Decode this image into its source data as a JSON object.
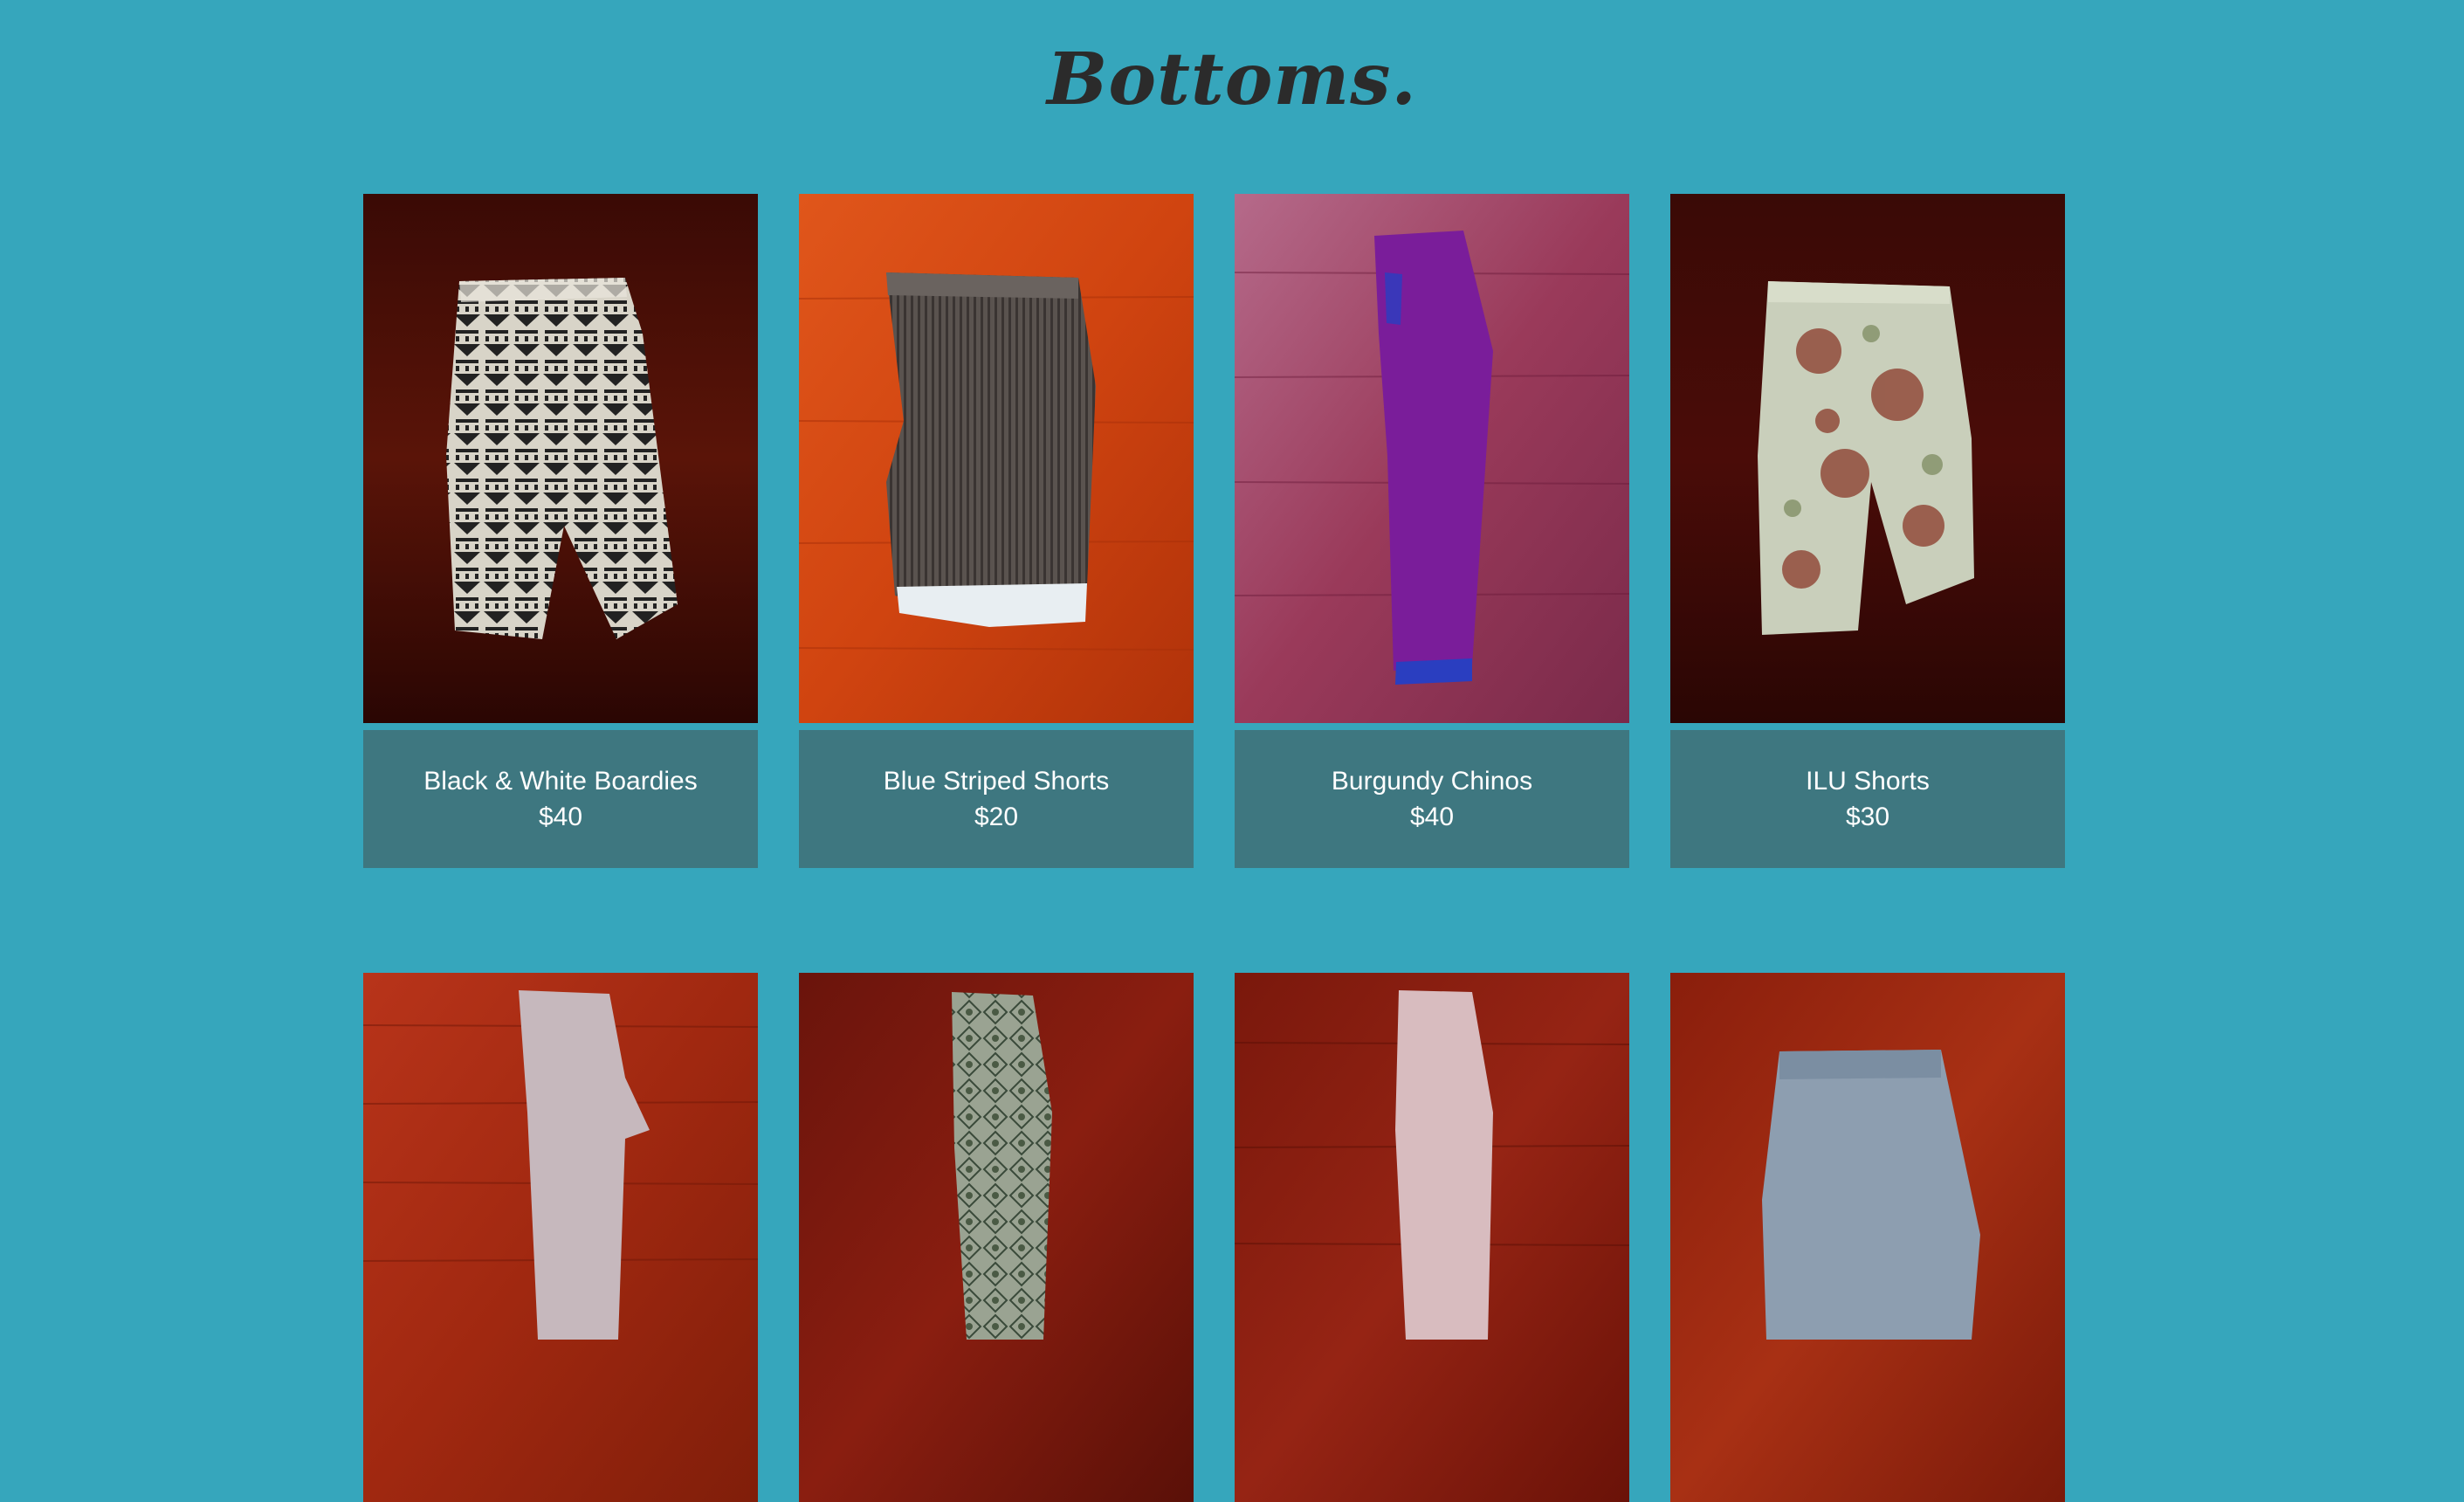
{
  "page": {
    "title": "Bottoms."
  },
  "products": [
    {
      "name": "Black & White Boardies",
      "price": "$40",
      "image_icon": "patterned-shorts-photo"
    },
    {
      "name": "Blue Striped Shorts",
      "price": "$20",
      "image_icon": "striped-shorts-photo"
    },
    {
      "name": "Burgundy Chinos",
      "price": "$40",
      "image_icon": "purple-chinos-photo"
    },
    {
      "name": "ILU Shorts",
      "price": "$30",
      "image_icon": "floral-shorts-photo"
    },
    {
      "image_icon": "grey-pants-photo"
    },
    {
      "image_icon": "paisley-pants-photo"
    },
    {
      "image_icon": "pink-pants-photo"
    },
    {
      "image_icon": "denim-shorts-photo"
    }
  ],
  "colors": {
    "background": "#36a6bc",
    "caption_background": "#3e7780",
    "title_text": "#2b2b2b",
    "caption_text": "#ffffff"
  }
}
